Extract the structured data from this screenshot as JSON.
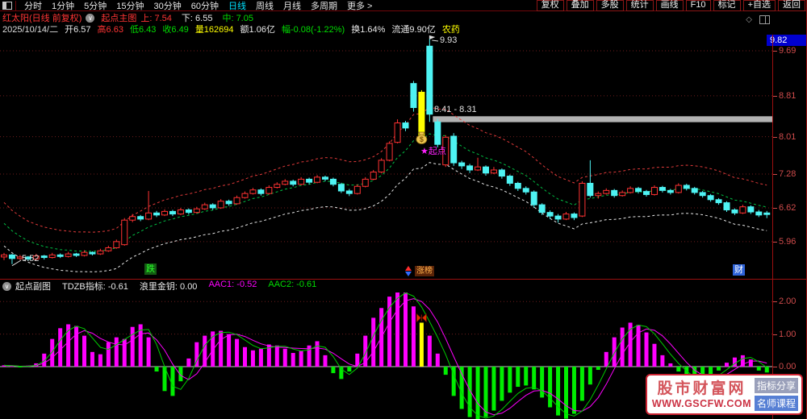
{
  "toolbar": {
    "periods": [
      {
        "label": "分时",
        "active": false
      },
      {
        "label": "1分钟",
        "active": false
      },
      {
        "label": "5分钟",
        "active": false
      },
      {
        "label": "15分钟",
        "active": false
      },
      {
        "label": "30分钟",
        "active": false
      },
      {
        "label": "60分钟",
        "active": false
      },
      {
        "label": "日线",
        "active": true
      },
      {
        "label": "周线",
        "active": false
      },
      {
        "label": "月线",
        "active": false
      },
      {
        "label": "多周期",
        "active": false
      }
    ],
    "more_label": "更多 >",
    "buttons": [
      "复权",
      "叠加",
      "多股",
      "统计",
      "画线",
      "F10",
      "标记",
      "+自选",
      "返回"
    ]
  },
  "info_bar": {
    "stock_title": "红太阳(日线 前复权)",
    "panel_name": "起点主图",
    "metrics": [
      {
        "label": "上:",
        "value": "7.54",
        "color": "#ff3434"
      },
      {
        "label": "下:",
        "value": "6.55",
        "color": "#e8e8e8"
      },
      {
        "label": "中:",
        "value": "7.05",
        "color": "#00dd00"
      }
    ]
  },
  "quote_bar": {
    "date": "2025/10/14/二",
    "fields": [
      {
        "text": "开6.57",
        "color": "#e8e8e8"
      },
      {
        "text": "高6.63",
        "color": "#ff3434"
      },
      {
        "text": "低6.43",
        "color": "#00dd00"
      },
      {
        "text": "收6.49",
        "color": "#00dd00"
      },
      {
        "text": "量162694",
        "color": "#ffff00"
      },
      {
        "text": "额1.06亿",
        "color": "#e8e8e8"
      },
      {
        "text": "幅-0.08(-1.22%)",
        "color": "#00dd00"
      },
      {
        "text": "换1.64%",
        "color": "#e8e8e8"
      },
      {
        "text": "流通9.90亿",
        "color": "#e8e8e8"
      },
      {
        "text": "农药",
        "color": "#ffff00"
      }
    ]
  },
  "main_chart": {
    "y_axis_top_value": "9.82",
    "y_axis": [
      {
        "label": "9.69",
        "price": 9.69
      },
      {
        "label": "8.81",
        "price": 8.81
      },
      {
        "label": "8.01",
        "price": 8.01
      },
      {
        "label": "7.28",
        "price": 7.28
      },
      {
        "label": "6.62",
        "price": 6.62
      },
      {
        "label": "5.96",
        "price": 5.96
      }
    ],
    "annotations": {
      "peak_label": "9.93",
      "band_label": "8.41 - 8.31",
      "low_label": "5.52",
      "signal_label": "★起点"
    },
    "badges": {
      "down": "跌",
      "rank": "涨榜",
      "fortune": "财"
    },
    "band": {
      "from_price": 8.41,
      "to_price": 8.31,
      "color": "#b2b2b2"
    },
    "colors": {
      "up": "#ff3232",
      "down": "#4ef3f3",
      "signal": "#ffff00",
      "envelope_upper": "#e03a3a",
      "envelope_mid": "#00c044",
      "envelope_lower": "#e8e8e8",
      "grid": "#6e1d1d",
      "label": "#cf4b4b"
    }
  },
  "sub_chart": {
    "header": {
      "panel_name": "起点副图",
      "items": [
        {
          "text": "TDZB指标: -0.61",
          "color": "#e8e8e8"
        },
        {
          "text": "浪里金钥: 0.00",
          "color": "#e8e8e8"
        },
        {
          "text": "AAC1: -0.52",
          "color": "#ff00ff"
        },
        {
          "text": "AAC2: -0.61",
          "color": "#00dd00"
        }
      ]
    },
    "y_axis": [
      {
        "label": "2.00",
        "value": 2
      },
      {
        "label": "1.00",
        "value": 1
      },
      {
        "label": "0.00",
        "value": 0
      }
    ],
    "colors": {
      "positive": "#ff00ff",
      "negative": "#00ee00",
      "signal": "#ffff00",
      "line_fast": "#00cc00",
      "line_slow": "#ff00ff",
      "zero": "#c9c9c9",
      "grid": "#6e1d1d"
    }
  },
  "watermark": {
    "title": "股市财富网",
    "url": "WWW.GSCFW.COM",
    "badge1": "指标分享",
    "badge2": "名师课程"
  },
  "chart_data": {
    "type": "candlestick+histogram",
    "signal_index": 52,
    "candles": [
      [
        5.66,
        5.74,
        5.6,
        5.7
      ],
      [
        5.7,
        5.72,
        5.52,
        5.63
      ],
      [
        5.63,
        5.7,
        5.6,
        5.66
      ],
      [
        5.66,
        5.68,
        5.58,
        5.62
      ],
      [
        5.62,
        5.72,
        5.6,
        5.68
      ],
      [
        5.68,
        5.7,
        5.61,
        5.65
      ],
      [
        5.65,
        5.74,
        5.63,
        5.7
      ],
      [
        5.7,
        5.73,
        5.64,
        5.67
      ],
      [
        5.67,
        5.76,
        5.65,
        5.72
      ],
      [
        5.72,
        5.74,
        5.66,
        5.69
      ],
      [
        5.69,
        5.79,
        5.67,
        5.75
      ],
      [
        5.75,
        5.77,
        5.69,
        5.72
      ],
      [
        5.72,
        5.82,
        5.7,
        5.78
      ],
      [
        5.78,
        5.88,
        5.76,
        5.84
      ],
      [
        5.84,
        6.0,
        5.82,
        5.96
      ],
      [
        5.9,
        6.42,
        5.88,
        6.38
      ],
      [
        6.38,
        6.5,
        6.34,
        6.45
      ],
      [
        6.45,
        6.48,
        6.36,
        6.4
      ],
      [
        6.4,
        6.95,
        6.38,
        6.52
      ],
      [
        6.52,
        6.56,
        6.44,
        6.48
      ],
      [
        6.48,
        6.59,
        6.46,
        6.55
      ],
      [
        6.55,
        6.58,
        6.46,
        6.5
      ],
      [
        6.5,
        6.62,
        6.48,
        6.58
      ],
      [
        6.58,
        6.61,
        6.49,
        6.53
      ],
      [
        6.53,
        6.64,
        6.51,
        6.6
      ],
      [
        6.6,
        6.72,
        6.58,
        6.68
      ],
      [
        6.68,
        6.71,
        6.58,
        6.62
      ],
      [
        6.62,
        6.79,
        6.6,
        6.75
      ],
      [
        6.75,
        6.78,
        6.66,
        6.7
      ],
      [
        6.7,
        6.86,
        6.68,
        6.82
      ],
      [
        6.82,
        6.94,
        6.8,
        6.9
      ],
      [
        6.9,
        7.01,
        6.88,
        6.97
      ],
      [
        6.97,
        7.0,
        6.86,
        6.9
      ],
      [
        6.9,
        7.06,
        6.88,
        7.02
      ],
      [
        7.02,
        7.12,
        7.0,
        7.08
      ],
      [
        7.08,
        7.18,
        7.06,
        7.14
      ],
      [
        7.14,
        7.17,
        7.04,
        7.08
      ],
      [
        7.08,
        7.22,
        7.06,
        7.18
      ],
      [
        7.18,
        7.21,
        7.08,
        7.12
      ],
      [
        7.12,
        7.26,
        7.1,
        7.22
      ],
      [
        7.22,
        7.25,
        7.14,
        7.18
      ],
      [
        7.18,
        7.21,
        7.04,
        7.08
      ],
      [
        7.08,
        7.11,
        6.91,
        6.95
      ],
      [
        6.95,
        6.99,
        6.85,
        6.9
      ],
      [
        6.9,
        7.08,
        6.88,
        7.04
      ],
      [
        7.04,
        7.22,
        7.02,
        7.18
      ],
      [
        7.18,
        7.36,
        7.16,
        7.32
      ],
      [
        7.32,
        7.59,
        7.3,
        7.55
      ],
      [
        7.55,
        7.92,
        7.53,
        7.88
      ],
      [
        7.9,
        8.35,
        7.88,
        8.28
      ],
      [
        8.28,
        8.32,
        8.12,
        8.18
      ],
      [
        9.05,
        9.1,
        8.5,
        8.58
      ],
      [
        8.88,
        8.92,
        7.92,
        7.96
      ],
      [
        9.78,
        9.93,
        8.3,
        8.45
      ],
      [
        8.3,
        8.36,
        7.8,
        7.86
      ],
      [
        7.46,
        8.04,
        7.42,
        8.0
      ],
      [
        8.02,
        8.08,
        7.44,
        7.5
      ],
      [
        7.5,
        7.54,
        7.38,
        7.44
      ],
      [
        7.44,
        7.48,
        7.3,
        7.36
      ],
      [
        7.36,
        7.6,
        7.34,
        7.42
      ],
      [
        7.42,
        7.45,
        7.25,
        7.3
      ],
      [
        7.3,
        7.42,
        7.28,
        7.36
      ],
      [
        7.36,
        7.39,
        7.19,
        7.24
      ],
      [
        7.24,
        7.27,
        7.05,
        7.1
      ],
      [
        7.1,
        7.13,
        6.95,
        7.0
      ],
      [
        7.0,
        7.04,
        6.88,
        6.93
      ],
      [
        6.93,
        6.96,
        6.62,
        6.68
      ],
      [
        6.68,
        6.71,
        6.48,
        6.53
      ],
      [
        6.53,
        6.57,
        6.4,
        6.46
      ],
      [
        6.46,
        6.5,
        6.33,
        6.4
      ],
      [
        6.4,
        6.54,
        6.38,
        6.5
      ],
      [
        6.5,
        6.53,
        6.38,
        6.43
      ],
      [
        6.46,
        7.14,
        6.44,
        7.1
      ],
      [
        7.1,
        7.55,
        6.82,
        6.86
      ],
      [
        6.86,
        6.94,
        6.8,
        6.9
      ],
      [
        6.9,
        7.0,
        6.88,
        6.96
      ],
      [
        6.96,
        6.99,
        6.82,
        6.86
      ],
      [
        6.86,
        6.96,
        6.84,
        6.92
      ],
      [
        6.92,
        7.04,
        6.9,
        7.0
      ],
      [
        7.0,
        7.03,
        6.9,
        6.94
      ],
      [
        6.94,
        6.97,
        6.84,
        6.88
      ],
      [
        6.88,
        7.06,
        6.86,
        7.02
      ],
      [
        7.02,
        7.05,
        6.92,
        6.96
      ],
      [
        6.96,
        6.99,
        6.88,
        6.92
      ],
      [
        6.92,
        7.1,
        6.9,
        7.06
      ],
      [
        7.06,
        7.09,
        6.96,
        7.0
      ],
      [
        7.0,
        7.03,
        6.88,
        6.92
      ],
      [
        6.92,
        6.95,
        6.82,
        6.86
      ],
      [
        6.86,
        6.89,
        6.74,
        6.78
      ],
      [
        6.78,
        6.81,
        6.68,
        6.72
      ],
      [
        6.72,
        6.75,
        6.54,
        6.58
      ],
      [
        6.58,
        6.61,
        6.48,
        6.52
      ],
      [
        6.52,
        6.68,
        6.5,
        6.64
      ],
      [
        6.64,
        6.67,
        6.5,
        6.54
      ],
      [
        6.54,
        6.58,
        6.44,
        6.48
      ],
      [
        6.52,
        6.56,
        6.42,
        6.49
      ]
    ],
    "sub_values": [
      0.04,
      0.02,
      -0.02,
      0.03,
      0.1,
      0.4,
      0.85,
      1.18,
      1.3,
      1.25,
      0.95,
      0.45,
      0.38,
      0.75,
      0.9,
      0.85,
      1.22,
      1.3,
      0.9,
      -0.15,
      -0.75,
      -0.9,
      -0.45,
      0.25,
      0.75,
      0.95,
      1.08,
      1.1,
      1.0,
      0.85,
      0.6,
      0.5,
      0.55,
      0.68,
      0.65,
      0.55,
      0.42,
      0.48,
      0.65,
      0.78,
      0.35,
      -0.2,
      -0.38,
      -0.15,
      0.4,
      0.95,
      1.5,
      1.8,
      2.15,
      2.35,
      2.3,
      1.85,
      1.35,
      0.95,
      0.4,
      -0.25,
      -0.9,
      -1.3,
      -1.55,
      -1.65,
      -1.55,
      -1.35,
      -1.05,
      -0.8,
      -0.62,
      -0.58,
      -0.7,
      -0.95,
      -1.25,
      -1.5,
      -1.6,
      -1.45,
      -1.05,
      -0.55,
      -0.1,
      0.45,
      0.9,
      1.2,
      1.35,
      1.28,
      1.05,
      0.7,
      0.35,
      0.1,
      -0.15,
      -0.35,
      -0.48,
      -0.42,
      -0.28,
      -0.12,
      0.12,
      0.28,
      0.35,
      0.22,
      -0.12,
      -0.18
    ]
  }
}
